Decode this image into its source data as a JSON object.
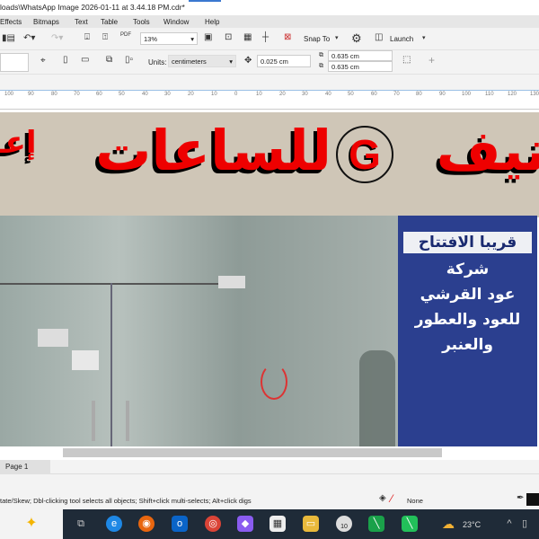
{
  "window": {
    "title": "loads\\WhatsApp Image 2026-01-11 at 3.44.18 PM.cdr*"
  },
  "menu": [
    "Effects",
    "Bitmaps",
    "Text",
    "Table",
    "Tools",
    "Window",
    "Help"
  ],
  "toolbar1": {
    "zoom": "13%",
    "snap_to": "Snap To",
    "launch": "Launch"
  },
  "toolbar2": {
    "units_label": "Units:",
    "units_value": "centimeters",
    "nudge": "0.025 cm",
    "dup_x": "0.635 cm",
    "dup_y": "0.635 cm"
  },
  "ruler": {
    "ticks": [
      "100",
      "90",
      "80",
      "70",
      "60",
      "50",
      "40",
      "30",
      "20",
      "10",
      "0",
      "10",
      "20",
      "30",
      "40",
      "50",
      "60",
      "70",
      "80",
      "90",
      "100",
      "110",
      "120",
      "130"
    ]
  },
  "canvas": {
    "banner_text": "نيف للساعات",
    "banner_logo": "G",
    "banner_left": "إعـ",
    "sign_lines": [
      "قريبا الافتتاح",
      "شركة",
      "عود القرشي",
      "للعود والعطور",
      "والعنبر"
    ]
  },
  "pages": {
    "tab": "Page 1"
  },
  "status": {
    "hint": "tate/Skew; Dbl-clicking tool selects all objects; Shift+click multi-selects; Alt+click digs",
    "fill": "None"
  },
  "taskbar": {
    "weather": "23°C",
    "badge": "10"
  }
}
